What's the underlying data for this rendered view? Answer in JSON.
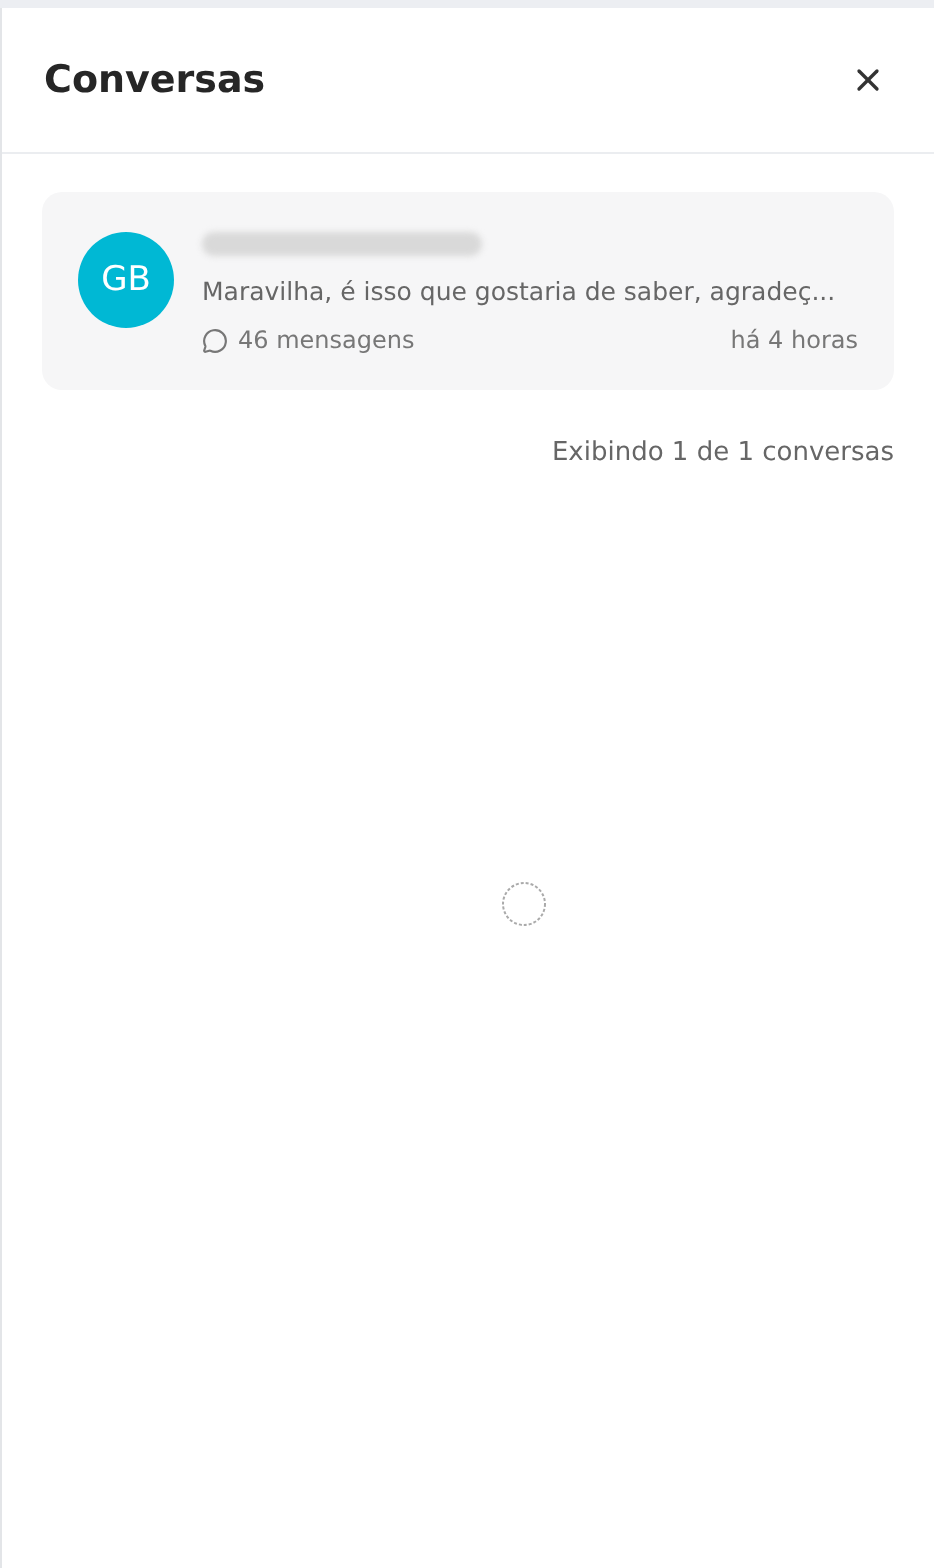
{
  "panel": {
    "title": "Conversas"
  },
  "conversations": [
    {
      "initials": "GB",
      "preview": "Maravilha, é isso que gostaria de saber, agradeç...",
      "messages": "46 mensagens",
      "time": "há 4 horas",
      "color": "#00b8d4"
    }
  ],
  "footer": "Exibindo 1 de 1 conversas"
}
